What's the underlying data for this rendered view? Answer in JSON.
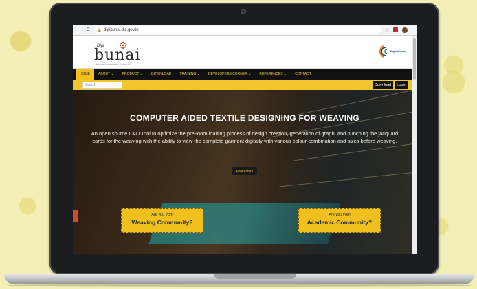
{
  "browser": {
    "url": "digibunai.dic.gov.in",
    "back_icon": "arrow-left-icon",
    "forward_icon": "arrow-right-icon",
    "reload_icon": "reload-icon",
    "star_icon": "star-icon",
    "menu_icon": "kebab-menu-icon"
  },
  "header": {
    "logo_small": "Digi",
    "logo_main": "bunai",
    "logo_tagline": "Weaves of Innovation | Bunai 4.0",
    "partner_logo_text": "Digital India"
  },
  "nav": {
    "items": [
      {
        "label": "HOME",
        "active": true
      },
      {
        "label": "ABOUT ⌄"
      },
      {
        "label": "PRODUCT ⌄"
      },
      {
        "label": "DOWNLOAD"
      },
      {
        "label": "TRAINING ⌄"
      },
      {
        "label": "DEVELOPERS CORNER ⌄"
      },
      {
        "label": "REFERENCES ⌄"
      },
      {
        "label": "CONTACT"
      }
    ]
  },
  "search": {
    "placeholder": "Search",
    "download_label": "Download",
    "login_label": "Login"
  },
  "hero": {
    "title": "COMPUTER AIDED TEXTILE DESIGNING FOR WEAVING",
    "description": "An open source CAD Tool to optimize the pre-loom loading process of design creation, generation of graph, and punching the jacquard cards for the weaving with the ability to view the complete garment digitally with various colour combination and sizes before weaving.",
    "learn_more": "Learn More",
    "cta_left_small": "Are you from",
    "cta_left_big": "Weaving Community?",
    "cta_right_small": "Are you from",
    "cta_right_big": "Academic Community?"
  },
  "colors": {
    "accent": "#f2bf1b",
    "nav_bg": "#111111",
    "page_bg": "#f4efb6"
  }
}
